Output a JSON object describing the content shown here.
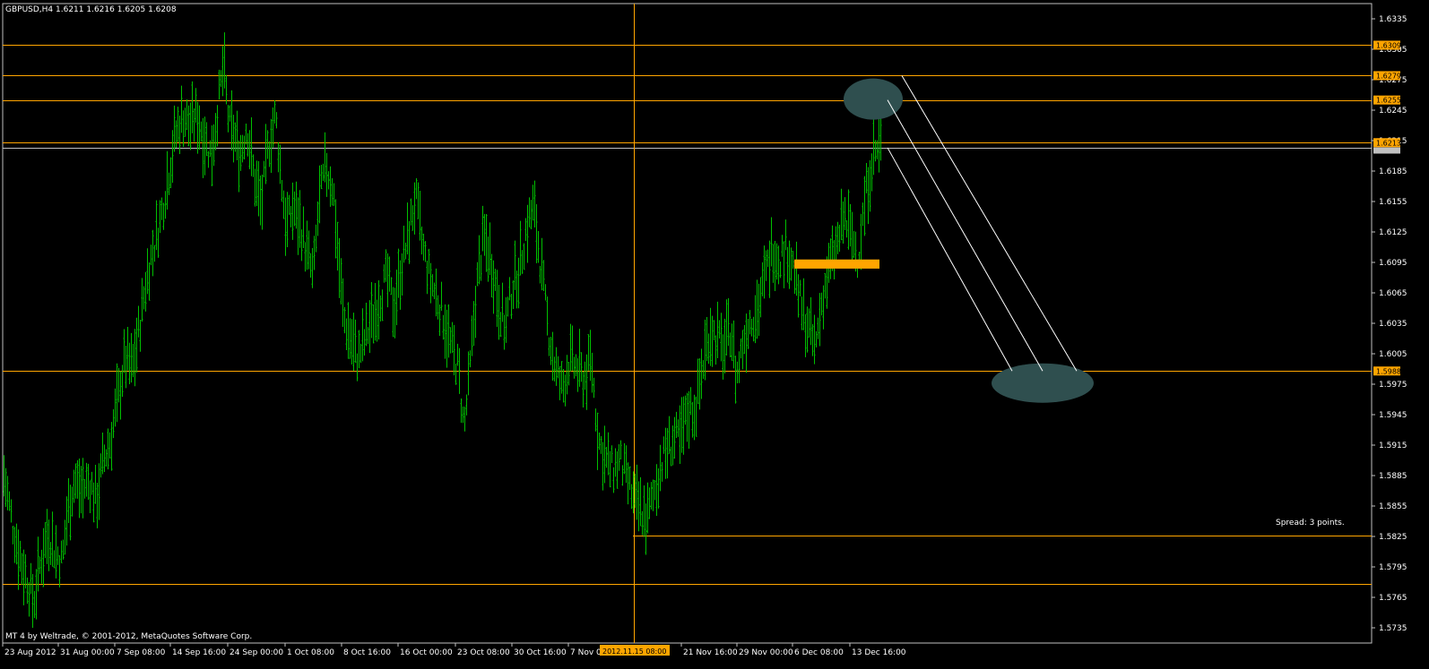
{
  "chart_data": {
    "type": "bar",
    "symbol_header": "GBPUSD,H4  1.6211 1.6216 1.6205 1.6208",
    "watermark": "MT 4 by Weltrade, © 2001-2012, MetaQuotes Software Corp.",
    "spread_text": "Spread: 3 points.",
    "ylim": [
      1.572,
      1.635
    ],
    "y_ticks": [
      "1.6335",
      "1.6305",
      "1.6275",
      "1.6245",
      "1.6215",
      "1.6185",
      "1.6155",
      "1.6125",
      "1.6095",
      "1.6065",
      "1.6035",
      "1.6005",
      "1.5975",
      "1.5945",
      "1.5915",
      "1.5885",
      "1.5855",
      "1.5825",
      "1.5795",
      "1.5765",
      "1.5735"
    ],
    "x_ticks": [
      "23 Aug 2012",
      "31 Aug 00:00",
      "7 Sep 08:00",
      "14 Sep 16:00",
      "24 Sep 00:00",
      "1 Oct 08:00",
      "8 Oct 16:00",
      "16 Oct 00:00",
      "23 Oct 08:00",
      "30 Oct 16:00",
      "7 Nov 00:00",
      "2012.11.15 08:00",
      "21 Nov 16:00",
      "29 Nov 00:00",
      "6 Dec 08:00",
      "13 Dec 16:00"
    ],
    "crosshair_time": "2012.11.15 08:00",
    "level_lines": [
      {
        "price": 1.6309,
        "label": "1.6309"
      },
      {
        "price": 1.6279,
        "label": "1.6279"
      },
      {
        "price": 1.6255,
        "label": "1.6255"
      },
      {
        "price": 1.6213,
        "label": "1.6213"
      },
      {
        "price": 1.5988,
        "label": "1.5988"
      },
      {
        "price": 1.5826,
        "label": ""
      },
      {
        "price": 1.5778,
        "label": ""
      }
    ],
    "bid_price": "1.6208",
    "path_points": [
      [
        0,
        1.589
      ],
      [
        10,
        1.584
      ],
      [
        20,
        1.58
      ],
      [
        28,
        1.578
      ],
      [
        34,
        1.576
      ],
      [
        42,
        1.58
      ],
      [
        50,
        1.583
      ],
      [
        58,
        1.581
      ],
      [
        66,
        1.58
      ],
      [
        72,
        1.585
      ],
      [
        80,
        1.588
      ],
      [
        88,
        1.587
      ],
      [
        96,
        1.588
      ],
      [
        104,
        1.586
      ],
      [
        112,
        1.59
      ],
      [
        120,
        1.592
      ],
      [
        128,
        1.596
      ],
      [
        136,
        1.6
      ],
      [
        144,
        1.599
      ],
      [
        152,
        1.603
      ],
      [
        160,
        1.608
      ],
      [
        168,
        1.611
      ],
      [
        176,
        1.614
      ],
      [
        184,
        1.618
      ],
      [
        192,
        1.622
      ],
      [
        200,
        1.624
      ],
      [
        208,
        1.623
      ],
      [
        216,
        1.624
      ],
      [
        224,
        1.622
      ],
      [
        232,
        1.62
      ],
      [
        240,
        1.625
      ],
      [
        246,
        1.629
      ],
      [
        252,
        1.623
      ],
      [
        258,
        1.622
      ],
      [
        264,
        1.62
      ],
      [
        272,
        1.623
      ],
      [
        280,
        1.618
      ],
      [
        288,
        1.615
      ],
      [
        296,
        1.621
      ],
      [
        304,
        1.624
      ],
      [
        310,
        1.618
      ],
      [
        316,
        1.613
      ],
      [
        324,
        1.615
      ],
      [
        332,
        1.613
      ],
      [
        340,
        1.61
      ],
      [
        346,
        1.608
      ],
      [
        352,
        1.615
      ],
      [
        360,
        1.619
      ],
      [
        368,
        1.617
      ],
      [
        374,
        1.61
      ],
      [
        380,
        1.604
      ],
      [
        388,
        1.602
      ],
      [
        396,
        1.6
      ],
      [
        404,
        1.602
      ],
      [
        412,
        1.604
      ],
      [
        420,
        1.606
      ],
      [
        428,
        1.608
      ],
      [
        436,
        1.605
      ],
      [
        444,
        1.609
      ],
      [
        452,
        1.612
      ],
      [
        460,
        1.616
      ],
      [
        468,
        1.611
      ],
      [
        476,
        1.608
      ],
      [
        484,
        1.606
      ],
      [
        492,
        1.604
      ],
      [
        500,
        1.601
      ],
      [
        508,
        1.599
      ],
      [
        514,
        1.593
      ],
      [
        520,
        1.598
      ],
      [
        528,
        1.607
      ],
      [
        536,
        1.612
      ],
      [
        544,
        1.61
      ],
      [
        552,
        1.606
      ],
      [
        560,
        1.603
      ],
      [
        568,
        1.607
      ],
      [
        576,
        1.609
      ],
      [
        584,
        1.613
      ],
      [
        592,
        1.615
      ],
      [
        600,
        1.609
      ],
      [
        608,
        1.603
      ],
      [
        616,
        1.599
      ],
      [
        624,
        1.597
      ],
      [
        632,
        1.6
      ],
      [
        640,
        1.599
      ],
      [
        648,
        1.598
      ],
      [
        656,
        1.6
      ],
      [
        664,
        1.592
      ],
      [
        672,
        1.59
      ],
      [
        680,
        1.589
      ],
      [
        688,
        1.59
      ],
      [
        696,
        1.588
      ],
      [
        704,
        1.586
      ],
      [
        712,
        1.585
      ],
      [
        718,
        1.584
      ],
      [
        724,
        1.586
      ],
      [
        732,
        1.589
      ],
      [
        740,
        1.591
      ],
      [
        748,
        1.592
      ],
      [
        756,
        1.592
      ],
      [
        764,
        1.595
      ],
      [
        772,
        1.595
      ],
      [
        780,
        1.599
      ],
      [
        788,
        1.603
      ],
      [
        796,
        1.602
      ],
      [
        804,
        1.601
      ],
      [
        812,
        1.603
      ],
      [
        818,
        1.598
      ],
      [
        826,
        1.602
      ],
      [
        834,
        1.604
      ],
      [
        842,
        1.605
      ],
      [
        850,
        1.608
      ],
      [
        858,
        1.611
      ],
      [
        866,
        1.61
      ],
      [
        874,
        1.611
      ],
      [
        882,
        1.609
      ],
      [
        890,
        1.605
      ],
      [
        898,
        1.603
      ],
      [
        906,
        1.601
      ],
      [
        914,
        1.606
      ],
      [
        922,
        1.609
      ],
      [
        930,
        1.611
      ],
      [
        938,
        1.614
      ],
      [
        946,
        1.612
      ],
      [
        954,
        1.61
      ],
      [
        962,
        1.616
      ],
      [
        970,
        1.62
      ],
      [
        980,
        1.6212
      ]
    ],
    "annotations": {
      "ellipses": [
        {
          "cx_time_index": 975,
          "cy_price": 1.6255
        },
        {
          "cx_time_index": 1160,
          "cy_price": 1.5977
        }
      ],
      "channel_lines": [
        {
          "from": [
            1003,
            1.6279
          ],
          "to": [
            1198,
            1.5988
          ]
        },
        {
          "from": [
            987,
            1.6255
          ],
          "to": [
            1160,
            1.5988
          ]
        },
        {
          "from": [
            987,
            1.6208
          ],
          "to": [
            1126,
            1.5988
          ]
        }
      ],
      "orange_zone": {
        "from_idx": 883,
        "to_idx": 978,
        "price_top": 1.6097,
        "price_bottom": 1.6088
      }
    },
    "colors": {
      "background": "#000000",
      "bars": "#00c000",
      "level_line": "#ffa500",
      "crosshair": "#ffa500",
      "bid_line": "#c0c0c0",
      "ellipse": "#2f4f4f",
      "spread_text": "#ff0000",
      "axis_text": "#ffffff"
    }
  }
}
